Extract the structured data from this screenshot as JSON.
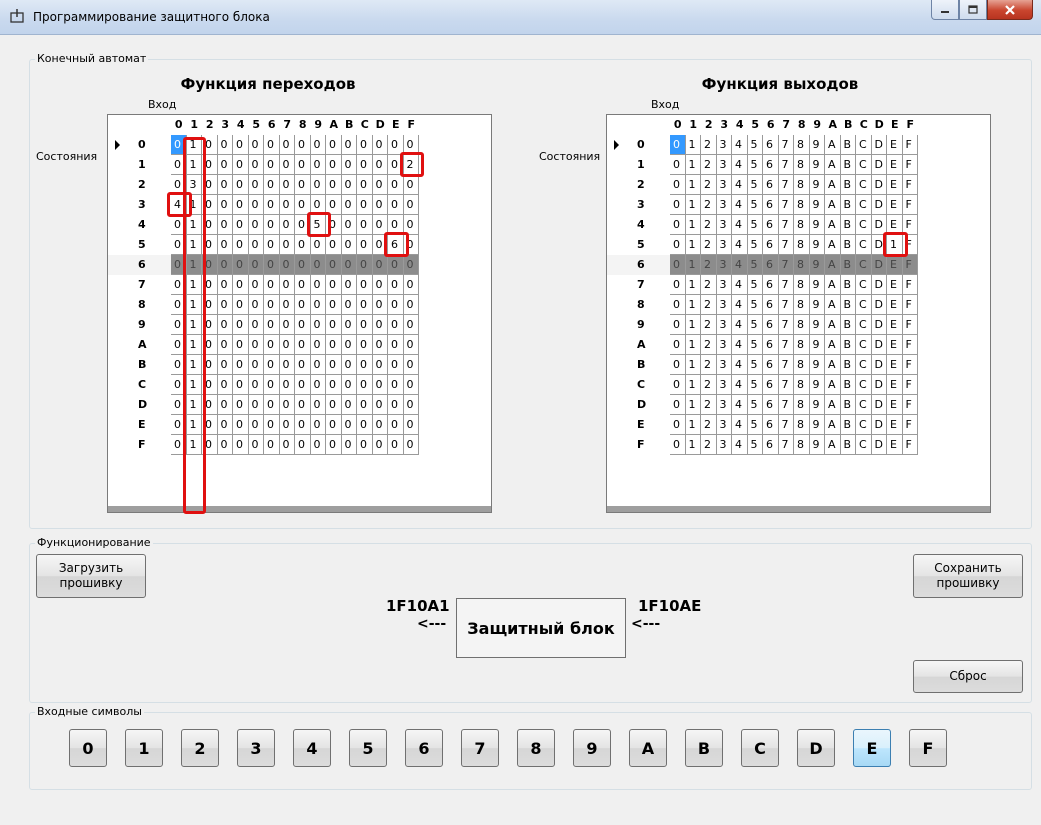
{
  "window": {
    "title": "Программирование защитного блока"
  },
  "automaton": {
    "label": "Конечный автомат",
    "transitions": {
      "title": "Функция переходов",
      "input_label": "Вход",
      "state_label": "Состояния",
      "columns": [
        "0",
        "1",
        "2",
        "3",
        "4",
        "5",
        "6",
        "7",
        "8",
        "9",
        "A",
        "B",
        "C",
        "D",
        "E",
        "F"
      ],
      "rows": [
        {
          "state": "0",
          "cells": [
            "0",
            "1",
            "0",
            "0",
            "0",
            "0",
            "0",
            "0",
            "0",
            "0",
            "0",
            "0",
            "0",
            "0",
            "0",
            "0"
          ]
        },
        {
          "state": "1",
          "cells": [
            "0",
            "1",
            "0",
            "0",
            "0",
            "0",
            "0",
            "0",
            "0",
            "0",
            "0",
            "0",
            "0",
            "0",
            "0",
            "2"
          ]
        },
        {
          "state": "2",
          "cells": [
            "0",
            "3",
            "0",
            "0",
            "0",
            "0",
            "0",
            "0",
            "0",
            "0",
            "0",
            "0",
            "0",
            "0",
            "0",
            "0"
          ]
        },
        {
          "state": "3",
          "cells": [
            "4",
            "1",
            "0",
            "0",
            "0",
            "0",
            "0",
            "0",
            "0",
            "0",
            "0",
            "0",
            "0",
            "0",
            "0",
            "0"
          ]
        },
        {
          "state": "4",
          "cells": [
            "0",
            "1",
            "0",
            "0",
            "0",
            "0",
            "0",
            "0",
            "0",
            "5",
            "0",
            "0",
            "0",
            "0",
            "0",
            "0"
          ]
        },
        {
          "state": "5",
          "cells": [
            "0",
            "1",
            "0",
            "0",
            "0",
            "0",
            "0",
            "0",
            "0",
            "0",
            "0",
            "0",
            "0",
            "0",
            "6",
            "0"
          ]
        },
        {
          "state": "6",
          "cells": [
            "0",
            "1",
            "0",
            "0",
            "0",
            "0",
            "0",
            "0",
            "0",
            "0",
            "0",
            "0",
            "0",
            "0",
            "0",
            "0"
          ]
        },
        {
          "state": "7",
          "cells": [
            "0",
            "1",
            "0",
            "0",
            "0",
            "0",
            "0",
            "0",
            "0",
            "0",
            "0",
            "0",
            "0",
            "0",
            "0",
            "0"
          ]
        },
        {
          "state": "8",
          "cells": [
            "0",
            "1",
            "0",
            "0",
            "0",
            "0",
            "0",
            "0",
            "0",
            "0",
            "0",
            "0",
            "0",
            "0",
            "0",
            "0"
          ]
        },
        {
          "state": "9",
          "cells": [
            "0",
            "1",
            "0",
            "0",
            "0",
            "0",
            "0",
            "0",
            "0",
            "0",
            "0",
            "0",
            "0",
            "0",
            "0",
            "0"
          ]
        },
        {
          "state": "A",
          "cells": [
            "0",
            "1",
            "0",
            "0",
            "0",
            "0",
            "0",
            "0",
            "0",
            "0",
            "0",
            "0",
            "0",
            "0",
            "0",
            "0"
          ]
        },
        {
          "state": "B",
          "cells": [
            "0",
            "1",
            "0",
            "0",
            "0",
            "0",
            "0",
            "0",
            "0",
            "0",
            "0",
            "0",
            "0",
            "0",
            "0",
            "0"
          ]
        },
        {
          "state": "C",
          "cells": [
            "0",
            "1",
            "0",
            "0",
            "0",
            "0",
            "0",
            "0",
            "0",
            "0",
            "0",
            "0",
            "0",
            "0",
            "0",
            "0"
          ]
        },
        {
          "state": "D",
          "cells": [
            "0",
            "1",
            "0",
            "0",
            "0",
            "0",
            "0",
            "0",
            "0",
            "0",
            "0",
            "0",
            "0",
            "0",
            "0",
            "0"
          ]
        },
        {
          "state": "E",
          "cells": [
            "0",
            "1",
            "0",
            "0",
            "0",
            "0",
            "0",
            "0",
            "0",
            "0",
            "0",
            "0",
            "0",
            "0",
            "0",
            "0"
          ]
        },
        {
          "state": "F",
          "cells": [
            "0",
            "1",
            "0",
            "0",
            "0",
            "0",
            "0",
            "0",
            "0",
            "0",
            "0",
            "0",
            "0",
            "0",
            "0",
            "0"
          ]
        }
      ],
      "selected_row": "6",
      "current_row": "0",
      "active_cell": {
        "row": "0",
        "col": "0"
      },
      "highlight_column": "1",
      "highlight_cells": [
        {
          "row": "1",
          "col": "F"
        },
        {
          "row": "3",
          "col": "0"
        },
        {
          "row": "4",
          "col": "9"
        },
        {
          "row": "5",
          "col": "E"
        }
      ]
    },
    "outputs": {
      "title": "Функция выходов",
      "input_label": "Вход",
      "state_label": "Состояния",
      "columns": [
        "0",
        "1",
        "2",
        "3",
        "4",
        "5",
        "6",
        "7",
        "8",
        "9",
        "A",
        "B",
        "C",
        "D",
        "E",
        "F"
      ],
      "rows": [
        {
          "state": "0",
          "cells": [
            "0",
            "1",
            "2",
            "3",
            "4",
            "5",
            "6",
            "7",
            "8",
            "9",
            "A",
            "B",
            "C",
            "D",
            "E",
            "F"
          ]
        },
        {
          "state": "1",
          "cells": [
            "0",
            "1",
            "2",
            "3",
            "4",
            "5",
            "6",
            "7",
            "8",
            "9",
            "A",
            "B",
            "C",
            "D",
            "E",
            "F"
          ]
        },
        {
          "state": "2",
          "cells": [
            "0",
            "1",
            "2",
            "3",
            "4",
            "5",
            "6",
            "7",
            "8",
            "9",
            "A",
            "B",
            "C",
            "D",
            "E",
            "F"
          ]
        },
        {
          "state": "3",
          "cells": [
            "0",
            "1",
            "2",
            "3",
            "4",
            "5",
            "6",
            "7",
            "8",
            "9",
            "A",
            "B",
            "C",
            "D",
            "E",
            "F"
          ]
        },
        {
          "state": "4",
          "cells": [
            "0",
            "1",
            "2",
            "3",
            "4",
            "5",
            "6",
            "7",
            "8",
            "9",
            "A",
            "B",
            "C",
            "D",
            "E",
            "F"
          ]
        },
        {
          "state": "5",
          "cells": [
            "0",
            "1",
            "2",
            "3",
            "4",
            "5",
            "6",
            "7",
            "8",
            "9",
            "A",
            "B",
            "C",
            "D",
            "1",
            "F"
          ]
        },
        {
          "state": "6",
          "cells": [
            "0",
            "1",
            "2",
            "3",
            "4",
            "5",
            "6",
            "7",
            "8",
            "9",
            "A",
            "B",
            "C",
            "D",
            "E",
            "F"
          ]
        },
        {
          "state": "7",
          "cells": [
            "0",
            "1",
            "2",
            "3",
            "4",
            "5",
            "6",
            "7",
            "8",
            "9",
            "A",
            "B",
            "C",
            "D",
            "E",
            "F"
          ]
        },
        {
          "state": "8",
          "cells": [
            "0",
            "1",
            "2",
            "3",
            "4",
            "5",
            "6",
            "7",
            "8",
            "9",
            "A",
            "B",
            "C",
            "D",
            "E",
            "F"
          ]
        },
        {
          "state": "9",
          "cells": [
            "0",
            "1",
            "2",
            "3",
            "4",
            "5",
            "6",
            "7",
            "8",
            "9",
            "A",
            "B",
            "C",
            "D",
            "E",
            "F"
          ]
        },
        {
          "state": "A",
          "cells": [
            "0",
            "1",
            "2",
            "3",
            "4",
            "5",
            "6",
            "7",
            "8",
            "9",
            "A",
            "B",
            "C",
            "D",
            "E",
            "F"
          ]
        },
        {
          "state": "B",
          "cells": [
            "0",
            "1",
            "2",
            "3",
            "4",
            "5",
            "6",
            "7",
            "8",
            "9",
            "A",
            "B",
            "C",
            "D",
            "E",
            "F"
          ]
        },
        {
          "state": "C",
          "cells": [
            "0",
            "1",
            "2",
            "3",
            "4",
            "5",
            "6",
            "7",
            "8",
            "9",
            "A",
            "B",
            "C",
            "D",
            "E",
            "F"
          ]
        },
        {
          "state": "D",
          "cells": [
            "0",
            "1",
            "2",
            "3",
            "4",
            "5",
            "6",
            "7",
            "8",
            "9",
            "A",
            "B",
            "C",
            "D",
            "E",
            "F"
          ]
        },
        {
          "state": "E",
          "cells": [
            "0",
            "1",
            "2",
            "3",
            "4",
            "5",
            "6",
            "7",
            "8",
            "9",
            "A",
            "B",
            "C",
            "D",
            "E",
            "F"
          ]
        },
        {
          "state": "F",
          "cells": [
            "0",
            "1",
            "2",
            "3",
            "4",
            "5",
            "6",
            "7",
            "8",
            "9",
            "A",
            "B",
            "C",
            "D",
            "E",
            "F"
          ]
        }
      ],
      "selected_row": "6",
      "current_row": "0",
      "active_cell": {
        "row": "0",
        "col": "0"
      },
      "highlight_cells": [
        {
          "row": "5",
          "col": "E"
        }
      ]
    }
  },
  "operation": {
    "label": "Функционирование",
    "load_button": "Загрузить прошивку",
    "save_button": "Сохранить прошивку",
    "reset_button": "Сброс",
    "input_code": "1F10A1",
    "output_code": "1F10AE",
    "arrow_left": "<---",
    "arrow_right": "<---",
    "block_label": "Защитный блок"
  },
  "input_symbols": {
    "label": "Входные символы",
    "keys": [
      "0",
      "1",
      "2",
      "3",
      "4",
      "5",
      "6",
      "7",
      "8",
      "9",
      "A",
      "B",
      "C",
      "D",
      "E",
      "F"
    ],
    "focused_key": "E"
  },
  "colors": {
    "accent": "#3399ff",
    "highlight": "#e01010",
    "selected_row": "#8c8c8c"
  }
}
